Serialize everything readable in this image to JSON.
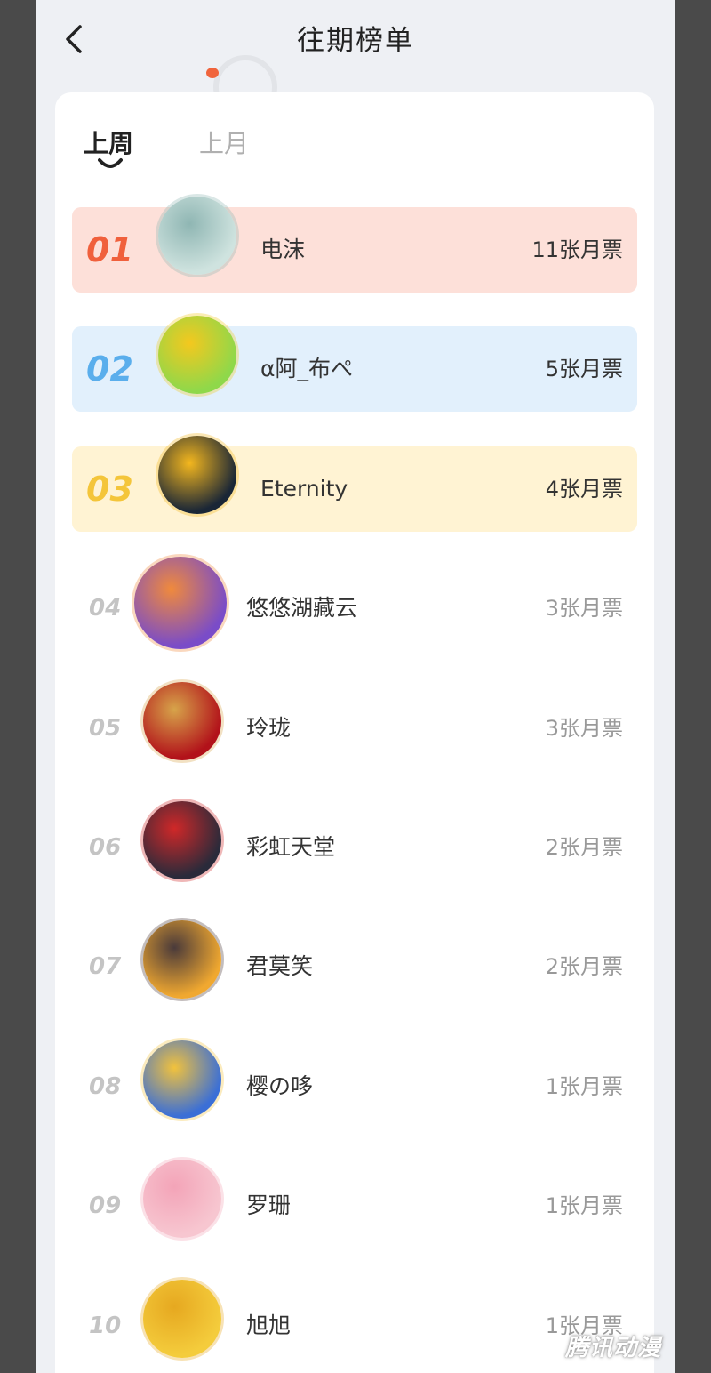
{
  "header": {
    "title": "往期榜单",
    "back_icon": "chevron-left-icon"
  },
  "tabs": [
    {
      "label": "上周",
      "active": true
    },
    {
      "label": "上月",
      "active": false
    }
  ],
  "ranking": [
    {
      "rank": "01",
      "name": "电沫",
      "votes": "11张月票",
      "bg": "#fde0d9",
      "color": "#f0603c",
      "avatar_colors": [
        "#cfe3df",
        "#8fb6b3"
      ]
    },
    {
      "rank": "02",
      "name": "α阿_布ぺ",
      "votes": "5张月票",
      "bg": "#e2f0fc",
      "color": "#5aaeec",
      "avatar_colors": [
        "#8fd84a",
        "#f4c81e"
      ]
    },
    {
      "rank": "03",
      "name": "Eternity",
      "votes": "4张月票",
      "bg": "#fff3d3",
      "color": "#f4c53a",
      "avatar_colors": [
        "#1a2636",
        "#f4b71e"
      ]
    },
    {
      "rank": "04",
      "name": "悠悠湖藏云",
      "votes": "3张月票",
      "bg": "",
      "color": "#c4c4c4",
      "avatar_colors": [
        "#7a4cc8",
        "#f08a3c"
      ]
    },
    {
      "rank": "05",
      "name": "玲珑",
      "votes": "3张月票",
      "bg": "",
      "color": "#c4c4c4",
      "avatar_colors": [
        "#b2121a",
        "#d7a44a"
      ]
    },
    {
      "rank": "06",
      "name": "彩虹天堂",
      "votes": "2张月票",
      "bg": "",
      "color": "#c4c4c4",
      "avatar_colors": [
        "#2a2a3a",
        "#d02828"
      ]
    },
    {
      "rank": "07",
      "name": "君莫笑",
      "votes": "2张月票",
      "bg": "",
      "color": "#c4c4c4",
      "avatar_colors": [
        "#f0a830",
        "#4a3a3a"
      ]
    },
    {
      "rank": "08",
      "name": "樱の哆",
      "votes": "1张月票",
      "bg": "",
      "color": "#c4c4c4",
      "avatar_colors": [
        "#3b6fd6",
        "#f2c23c"
      ]
    },
    {
      "rank": "09",
      "name": "罗珊",
      "votes": "1张月票",
      "bg": "",
      "color": "#c4c4c4",
      "avatar_colors": [
        "#f7c6d0",
        "#f3a4b8"
      ]
    },
    {
      "rank": "10",
      "name": "旭旭",
      "votes": "1张月票",
      "bg": "",
      "color": "#c4c4c4",
      "avatar_colors": [
        "#f4cc3c",
        "#e6a820"
      ]
    }
  ],
  "watermark": "腾讯动漫"
}
